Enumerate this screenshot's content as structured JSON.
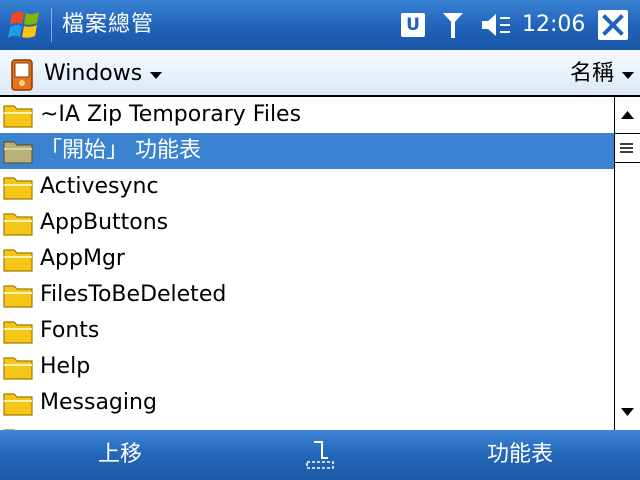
{
  "titlebar": {
    "app_title": "檔案總管",
    "notification_badge": "U",
    "clock": "12:06"
  },
  "toolbar": {
    "folder_name": "Windows",
    "sort_label": "名稱"
  },
  "file_list": {
    "selected_index": 1,
    "items": [
      {
        "label": "~IA Zip Temporary Files"
      },
      {
        "label": "「開始」 功能表"
      },
      {
        "label": "Activesync"
      },
      {
        "label": "AppButtons"
      },
      {
        "label": "AppMgr"
      },
      {
        "label": "FilesToBeDeleted"
      },
      {
        "label": "Fonts"
      },
      {
        "label": "Help"
      },
      {
        "label": "Messaging"
      }
    ]
  },
  "softkeys": {
    "left": "上移",
    "right": "功能表"
  },
  "colors": {
    "title_bar": "#1f62b8",
    "selection": "#3b82d0",
    "folder": "#f5c518"
  },
  "icons": {
    "start": "windows-flag-icon",
    "signal": "antenna-signal-icon",
    "volume": "speaker-muted-icon",
    "close": "close-x-icon",
    "device": "pocket-pc-icon",
    "folder": "folder-icon",
    "sip": "keyboard-input-icon"
  }
}
